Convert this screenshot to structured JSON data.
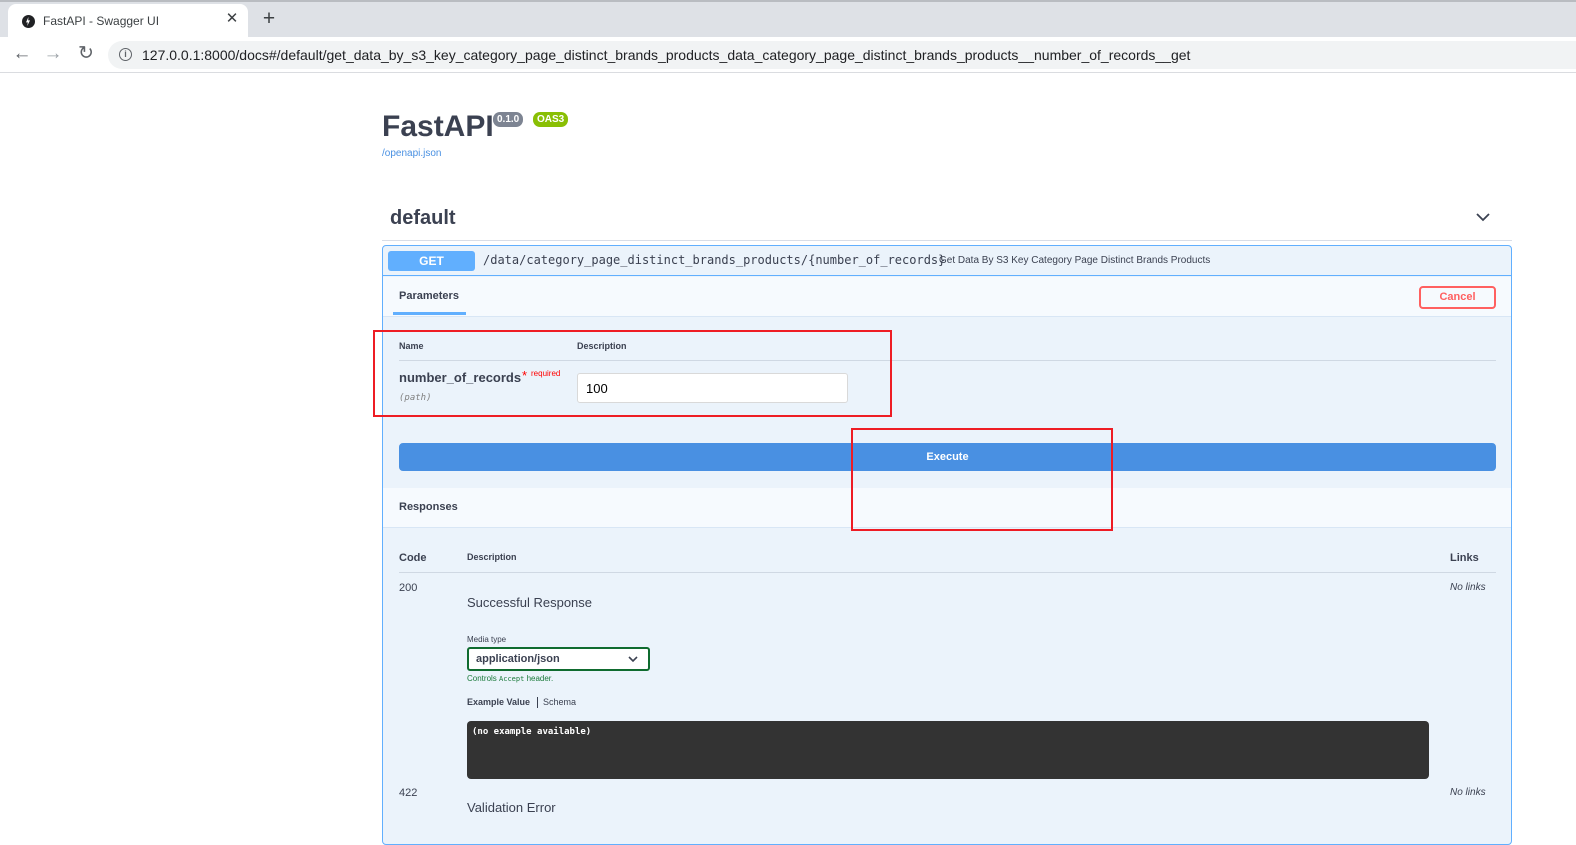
{
  "browser": {
    "tab_title": "FastAPI - Swagger UI",
    "tab_close": "✕",
    "new_tab": "+",
    "url": "127.0.0.1:8000/docs#/default/get_data_by_s3_key_category_page_distinct_brands_products_data_category_page_distinct_brands_products__number_of_records__get"
  },
  "header": {
    "title": "FastAPI",
    "version": "0.1.0",
    "oas": "OAS3",
    "spec_link": "/openapi.json"
  },
  "section": {
    "title": "default"
  },
  "operation": {
    "method": "GET",
    "path": "/data/category_page_distinct_brands_products/{number_of_records}",
    "summary": "Get Data By S3 Key Category Page Distinct Brands Products",
    "parameters_tab": "Parameters",
    "cancel_label": "Cancel",
    "columns": {
      "name": "Name",
      "description": "Description"
    },
    "parameter": {
      "name": "number_of_records",
      "required_star": "*",
      "required_label": "required",
      "in": "(path)",
      "value": "100"
    },
    "execute_label": "Execute"
  },
  "responses": {
    "title": "Responses",
    "columns": {
      "code": "Code",
      "description": "Description",
      "links": "Links"
    },
    "items": [
      {
        "code": "200",
        "description": "Successful Response",
        "links": "No links",
        "media_type_label": "Media type",
        "media_type": "application/json",
        "controls_prefix": "Controls",
        "controls_code": "Accept",
        "controls_suffix": "header.",
        "example_tab": "Example Value",
        "schema_tab": "Schema",
        "example": "(no example available)"
      },
      {
        "code": "422",
        "description": "Validation Error",
        "links": "No links"
      }
    ]
  },
  "colors": {
    "get_accent": "#61affe",
    "execute": "#4990e2",
    "cancel": "#ff6060",
    "annotation": "#ee1c24",
    "oas_badge": "#89bf04"
  }
}
